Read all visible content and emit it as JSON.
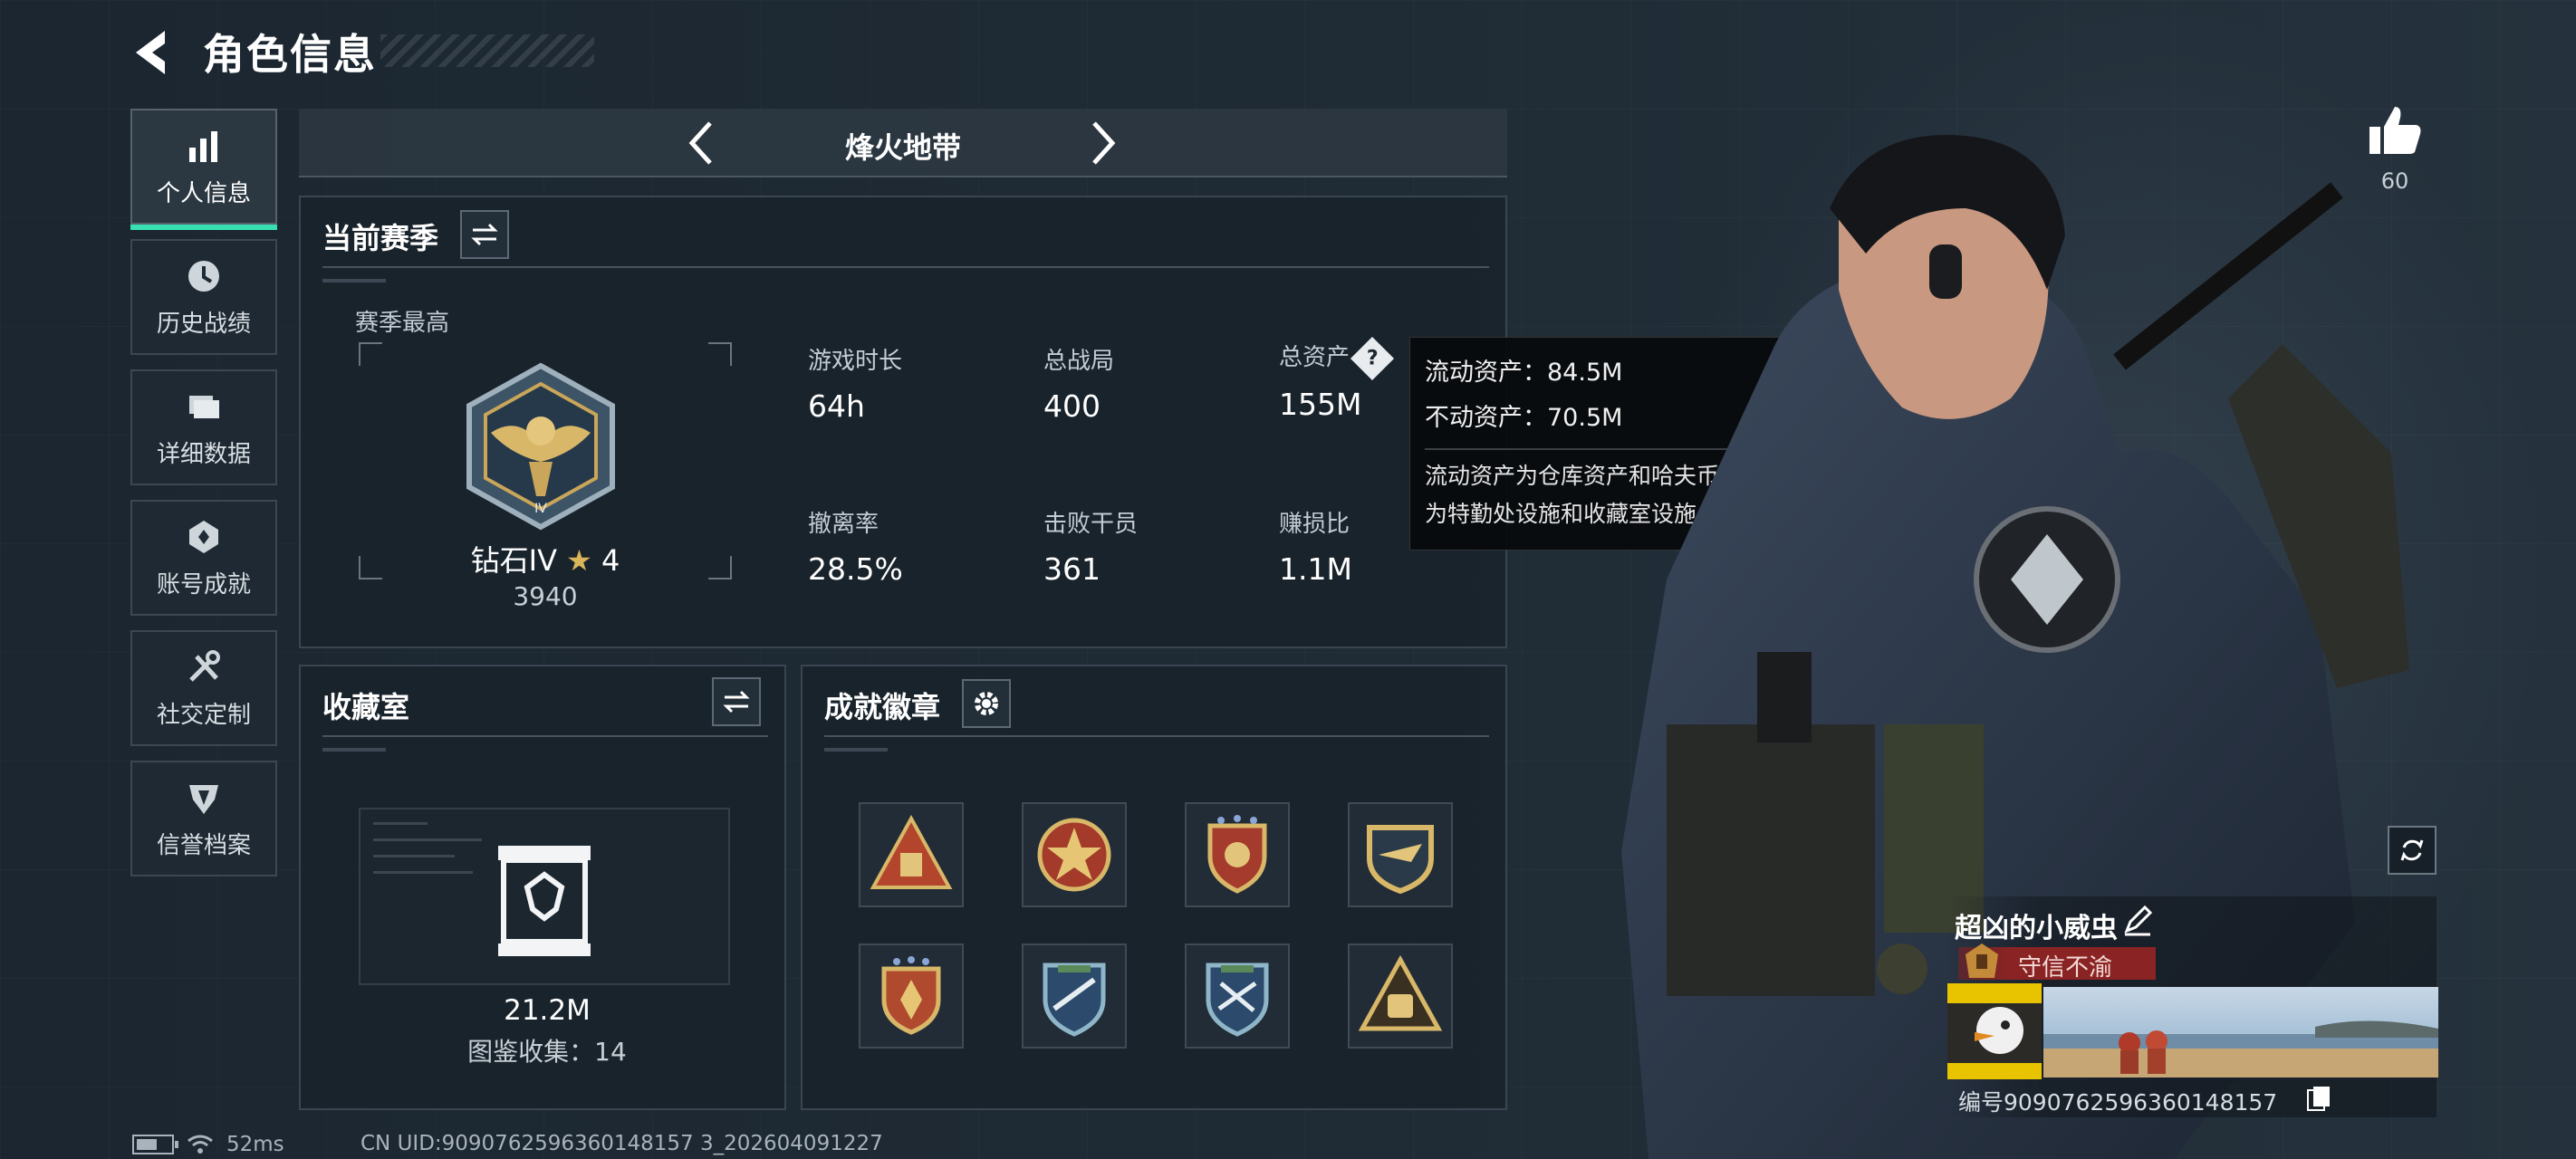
{
  "header": {
    "title": "角色信息"
  },
  "sidebar": {
    "items": [
      {
        "label": "个人信息",
        "icon": "bar-chart-icon",
        "active": true
      },
      {
        "label": "历史战绩",
        "icon": "history-clock-icon",
        "active": false
      },
      {
        "label": "详细数据",
        "icon": "folder-icon",
        "active": false
      },
      {
        "label": "账号成就",
        "icon": "achievement-icon",
        "active": false
      },
      {
        "label": "社交定制",
        "icon": "tools-icon",
        "active": false
      },
      {
        "label": "信誉档案",
        "icon": "credit-shield-icon",
        "active": false
      }
    ]
  },
  "mode": {
    "title": "烽火地带"
  },
  "season": {
    "title": "当前赛季",
    "best_label": "赛季最高",
    "rank_name": "钻石IV",
    "rank_stars": "4",
    "rank_score": "3940",
    "stats": [
      {
        "label": "游戏时长",
        "value": "64h"
      },
      {
        "label": "总战局",
        "value": "400"
      },
      {
        "label": "总资产",
        "value": "155M"
      },
      {
        "label": "撤离率",
        "value": "28.5%"
      },
      {
        "label": "击败干员",
        "value": "361"
      },
      {
        "label": "赚损比",
        "value": "1.1M"
      }
    ]
  },
  "tooltip": {
    "liquid": "流动资产：84.5M",
    "fixed": "不动资产：70.5M",
    "desc_line1": "流动资产为仓库资产和哈夫币，不动资产",
    "desc_line2": "为特勤处设施和收藏室设施"
  },
  "collection": {
    "title": "收藏室",
    "value": "21.2M",
    "count_text": "图鉴收集：14"
  },
  "badges": {
    "title": "成就徽章",
    "items": [
      {
        "icon": "triangle-gold-badge-icon"
      },
      {
        "icon": "red-star-badge-icon"
      },
      {
        "icon": "red-shield-stars-badge-icon"
      },
      {
        "icon": "gold-wing-badge-icon"
      },
      {
        "icon": "red-crest-stars-badge-icon"
      },
      {
        "icon": "blue-rifle-badge-icon"
      },
      {
        "icon": "blue-cross-badge-icon"
      },
      {
        "icon": "gold-triangle-bag-badge-icon"
      }
    ]
  },
  "likes": {
    "count": "60"
  },
  "profile": {
    "name": "超凶的小威虫",
    "title_tag": "守信不渝",
    "id_text": "编号9090762596360148157"
  },
  "status": {
    "ping": "52ms",
    "uid": "CN UID:9090762596360148157 3_202604091227"
  },
  "colors": {
    "accent": "#37e0b0",
    "title_tag": "#8a2424",
    "rank_star": "#d9b45a"
  }
}
